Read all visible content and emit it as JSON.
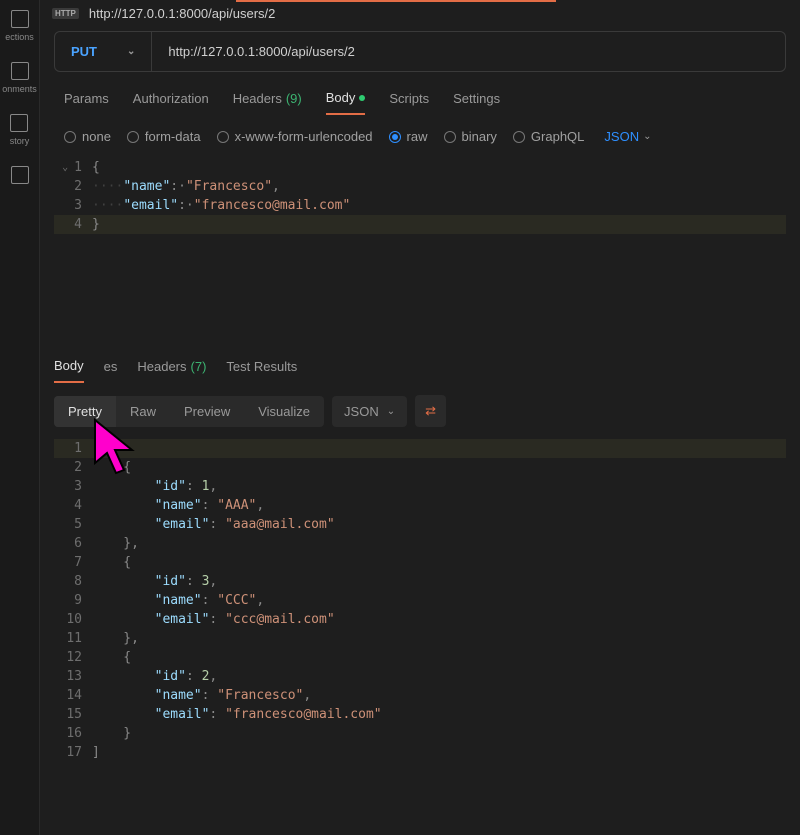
{
  "sidebar": {
    "items": [
      {
        "icon": "collections",
        "label": "ections"
      },
      {
        "icon": "env",
        "label": "onments"
      },
      {
        "icon": "history",
        "label": "story"
      },
      {
        "icon": "flows",
        "label": ""
      }
    ]
  },
  "tab": {
    "http_badge": "HTTP",
    "title": "http://127.0.0.1:8000/api/users/2"
  },
  "request": {
    "method": "PUT",
    "url": "http://127.0.0.1:8000/api/users/2"
  },
  "req_tabs": {
    "items": [
      {
        "label": "Params"
      },
      {
        "label": "Authorization"
      },
      {
        "label": "Headers",
        "count": "(9)"
      },
      {
        "label": "Body",
        "active": true,
        "dot": true
      },
      {
        "label": "Scripts"
      },
      {
        "label": "Settings"
      }
    ]
  },
  "body_types": {
    "options": [
      {
        "label": "none"
      },
      {
        "label": "form-data"
      },
      {
        "label": "x-www-form-urlencoded"
      },
      {
        "label": "raw",
        "selected": true
      },
      {
        "label": "binary"
      },
      {
        "label": "GraphQL"
      }
    ],
    "format": "JSON"
  },
  "req_body_lines": [
    {
      "n": "1",
      "fold": true,
      "tokens": [
        {
          "t": "p",
          "v": "{"
        }
      ]
    },
    {
      "n": "2",
      "tokens": [
        {
          "t": "ind",
          "v": "····"
        },
        {
          "t": "k",
          "v": "\"name\""
        },
        {
          "t": "p",
          "v": ":·"
        },
        {
          "t": "s",
          "v": "\"Francesco\""
        },
        {
          "t": "p",
          "v": ","
        }
      ]
    },
    {
      "n": "3",
      "tokens": [
        {
          "t": "ind",
          "v": "····"
        },
        {
          "t": "k",
          "v": "\"email\""
        },
        {
          "t": "p",
          "v": ":·"
        },
        {
          "t": "s",
          "v": "\"francesco@mail.com\""
        }
      ]
    },
    {
      "n": "4",
      "hl": true,
      "tokens": [
        {
          "t": "p",
          "v": "}"
        }
      ]
    }
  ],
  "resp_tabs": {
    "items": [
      {
        "label": "Body",
        "active": true
      },
      {
        "label": "es"
      },
      {
        "label": "Headers",
        "count": "(7)"
      },
      {
        "label": "Test Results"
      }
    ]
  },
  "resp_toolbar": {
    "views": [
      {
        "label": "Pretty",
        "active": true
      },
      {
        "label": "Raw"
      },
      {
        "label": "Preview"
      },
      {
        "label": "Visualize"
      }
    ],
    "format": "JSON"
  },
  "resp_body_lines": [
    {
      "n": "1",
      "hl": true,
      "tokens": [
        {
          "t": "p",
          "v": "["
        }
      ]
    },
    {
      "n": "2",
      "tokens": [
        {
          "t": "p",
          "v": "    {"
        }
      ]
    },
    {
      "n": "3",
      "tokens": [
        {
          "t": "p",
          "v": "        "
        },
        {
          "t": "k",
          "v": "\"id\""
        },
        {
          "t": "p",
          "v": ": "
        },
        {
          "t": "n",
          "v": "1"
        },
        {
          "t": "p",
          "v": ","
        }
      ]
    },
    {
      "n": "4",
      "tokens": [
        {
          "t": "p",
          "v": "        "
        },
        {
          "t": "k",
          "v": "\"name\""
        },
        {
          "t": "p",
          "v": ": "
        },
        {
          "t": "s",
          "v": "\"AAA\""
        },
        {
          "t": "p",
          "v": ","
        }
      ]
    },
    {
      "n": "5",
      "tokens": [
        {
          "t": "p",
          "v": "        "
        },
        {
          "t": "k",
          "v": "\"email\""
        },
        {
          "t": "p",
          "v": ": "
        },
        {
          "t": "s",
          "v": "\"aaa@mail.com\""
        }
      ]
    },
    {
      "n": "6",
      "tokens": [
        {
          "t": "p",
          "v": "    },"
        }
      ]
    },
    {
      "n": "7",
      "tokens": [
        {
          "t": "p",
          "v": "    {"
        }
      ]
    },
    {
      "n": "8",
      "tokens": [
        {
          "t": "p",
          "v": "        "
        },
        {
          "t": "k",
          "v": "\"id\""
        },
        {
          "t": "p",
          "v": ": "
        },
        {
          "t": "n",
          "v": "3"
        },
        {
          "t": "p",
          "v": ","
        }
      ]
    },
    {
      "n": "9",
      "tokens": [
        {
          "t": "p",
          "v": "        "
        },
        {
          "t": "k",
          "v": "\"name\""
        },
        {
          "t": "p",
          "v": ": "
        },
        {
          "t": "s",
          "v": "\"CCC\""
        },
        {
          "t": "p",
          "v": ","
        }
      ]
    },
    {
      "n": "10",
      "tokens": [
        {
          "t": "p",
          "v": "        "
        },
        {
          "t": "k",
          "v": "\"email\""
        },
        {
          "t": "p",
          "v": ": "
        },
        {
          "t": "s",
          "v": "\"ccc@mail.com\""
        }
      ]
    },
    {
      "n": "11",
      "tokens": [
        {
          "t": "p",
          "v": "    },"
        }
      ]
    },
    {
      "n": "12",
      "tokens": [
        {
          "t": "p",
          "v": "    {"
        }
      ]
    },
    {
      "n": "13",
      "tokens": [
        {
          "t": "p",
          "v": "        "
        },
        {
          "t": "k",
          "v": "\"id\""
        },
        {
          "t": "p",
          "v": ": "
        },
        {
          "t": "n",
          "v": "2"
        },
        {
          "t": "p",
          "v": ","
        }
      ]
    },
    {
      "n": "14",
      "tokens": [
        {
          "t": "p",
          "v": "        "
        },
        {
          "t": "k",
          "v": "\"name\""
        },
        {
          "t": "p",
          "v": ": "
        },
        {
          "t": "s",
          "v": "\"Francesco\""
        },
        {
          "t": "p",
          "v": ","
        }
      ]
    },
    {
      "n": "15",
      "tokens": [
        {
          "t": "p",
          "v": "        "
        },
        {
          "t": "k",
          "v": "\"email\""
        },
        {
          "t": "p",
          "v": ": "
        },
        {
          "t": "s",
          "v": "\"francesco@mail.com\""
        }
      ]
    },
    {
      "n": "16",
      "tokens": [
        {
          "t": "p",
          "v": "    }"
        }
      ]
    },
    {
      "n": "17",
      "tokens": [
        {
          "t": "p",
          "v": "]"
        }
      ]
    }
  ]
}
